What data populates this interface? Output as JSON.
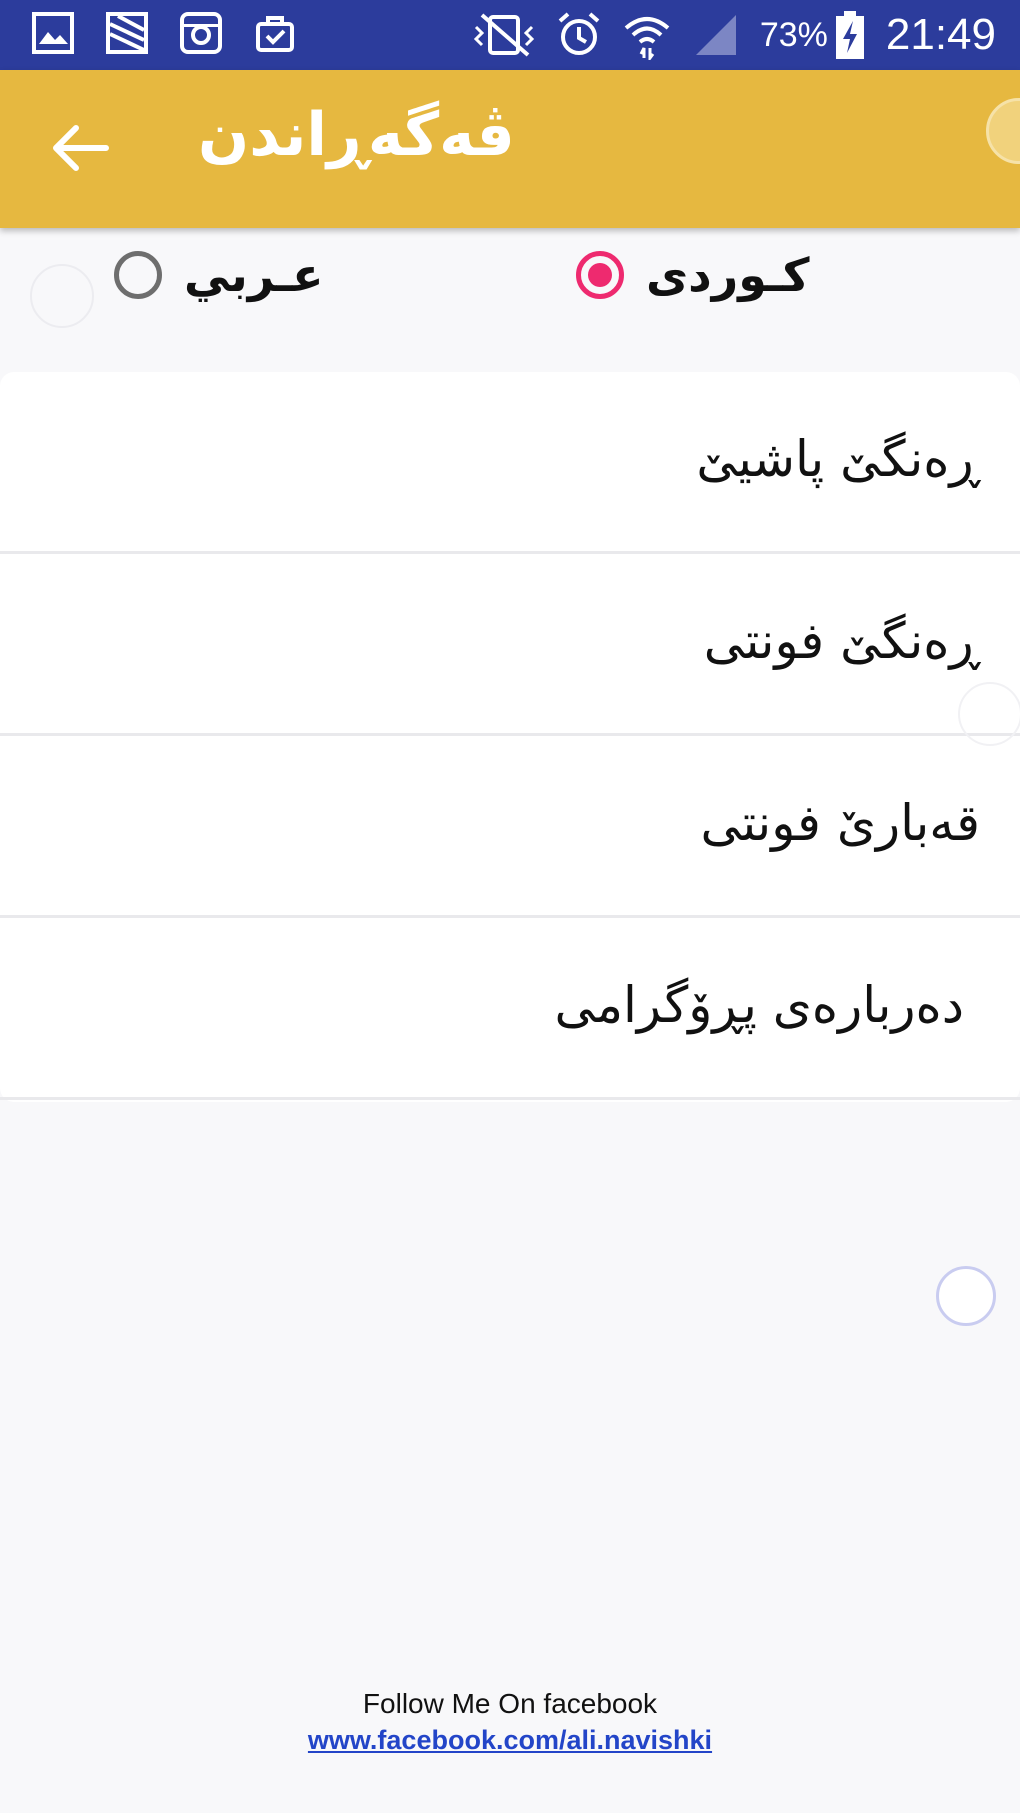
{
  "status_bar": {
    "battery_percent": "73%",
    "time": "21:49",
    "left_icons": [
      "gallery-icon",
      "photo-edit-icon",
      "instagram-icon",
      "shop-bag-icon"
    ],
    "right_icons": [
      "vibrate-mute-icon",
      "alarm-icon",
      "wifi-icon",
      "signal-icon",
      "battery-charging-icon"
    ]
  },
  "app_bar": {
    "title": "ڤەگەڕاندن",
    "back_icon": "arrow-back-icon",
    "color": "#e6b840"
  },
  "language": {
    "options": [
      {
        "label": "عـربي",
        "selected": false
      },
      {
        "label": "كـوردی",
        "selected": true
      }
    ],
    "accent_color": "#ee2a6f"
  },
  "settings": {
    "items": [
      {
        "label": "ڕەنگێ پاشیێ"
      },
      {
        "label": "ڕەنگێ فونتی"
      },
      {
        "label": "قەبارێ فونتی"
      },
      {
        "label": "دەربارەی پڕۆگرامی"
      }
    ]
  },
  "footer": {
    "text": "Follow Me On facebook",
    "link": "www.facebook.com/ali.navishki",
    "link_color": "#2345c8"
  }
}
